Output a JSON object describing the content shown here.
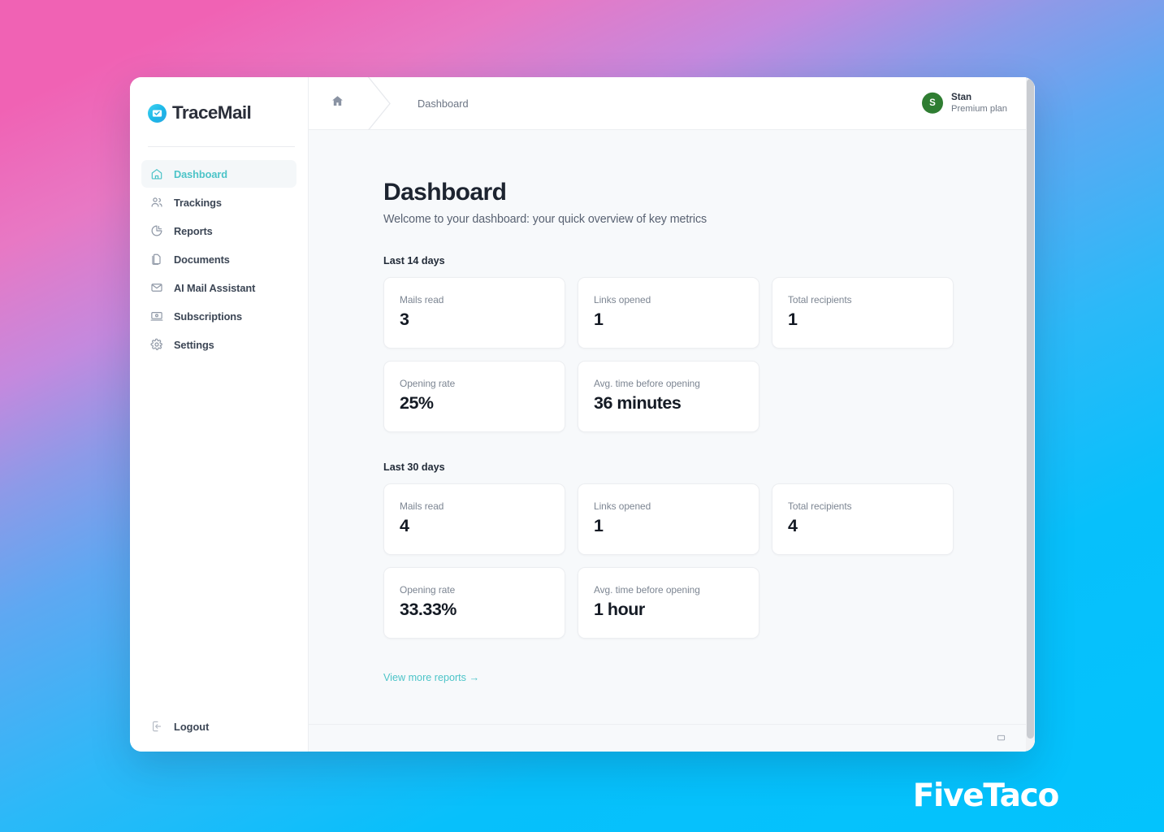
{
  "brand": {
    "name": "TraceMail",
    "logo_icon": "envelope-check-icon",
    "accent_color": "#4cc4c8",
    "logo_gradient_from": "#41d3f0",
    "logo_gradient_to": "#2aa8e2"
  },
  "sidebar": {
    "items": [
      {
        "label": "Dashboard",
        "icon": "home-icon",
        "active": true
      },
      {
        "label": "Trackings",
        "icon": "users-icon",
        "active": false
      },
      {
        "label": "Reports",
        "icon": "pie-chart-icon",
        "active": false
      },
      {
        "label": "Documents",
        "icon": "documents-icon",
        "active": false
      },
      {
        "label": "AI Mail Assistant",
        "icon": "envelope-icon",
        "active": false
      },
      {
        "label": "Subscriptions",
        "icon": "card-terminal-icon",
        "active": false
      },
      {
        "label": "Settings",
        "icon": "gear-icon",
        "active": false
      }
    ],
    "logout": {
      "label": "Logout",
      "icon": "logout-icon"
    }
  },
  "topbar": {
    "home_icon": "home-icon",
    "breadcrumb": "Dashboard",
    "user": {
      "avatar_initial": "S",
      "avatar_color": "#2f7d32",
      "name": "Stan",
      "plan": "Premium plan"
    }
  },
  "main": {
    "title": "Dashboard",
    "subtitle": "Welcome to your dashboard: your quick overview of key metrics",
    "sections": [
      {
        "label": "Last 14 days",
        "row1": [
          {
            "label": "Mails read",
            "value": "3"
          },
          {
            "label": "Links opened",
            "value": "1"
          },
          {
            "label": "Total recipients",
            "value": "1"
          }
        ],
        "row2": [
          {
            "label": "Opening rate",
            "value": "25%"
          },
          {
            "label": "Avg. time before opening",
            "value": "36 minutes"
          }
        ]
      },
      {
        "label": "Last 30 days",
        "row1": [
          {
            "label": "Mails read",
            "value": "4"
          },
          {
            "label": "Links opened",
            "value": "1"
          },
          {
            "label": "Total recipients",
            "value": "4"
          }
        ],
        "row2": [
          {
            "label": "Opening rate",
            "value": "33.33%"
          },
          {
            "label": "Avg. time before opening",
            "value": "1 hour"
          }
        ]
      }
    ],
    "view_more_link": "View more reports →"
  },
  "footer": {
    "left": "",
    "right": ""
  },
  "watermark": {
    "text": "FiveTaco"
  }
}
